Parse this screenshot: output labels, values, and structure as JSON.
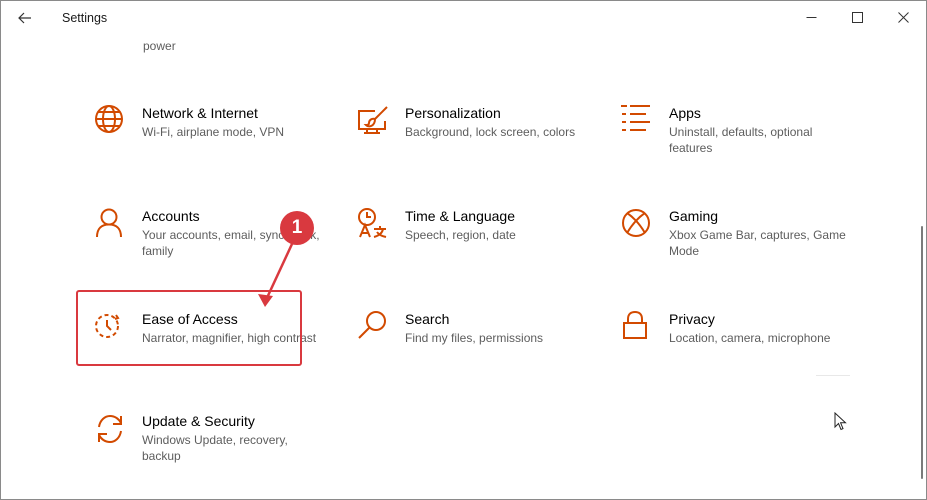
{
  "window": {
    "title": "Settings",
    "back_icon": "back-arrow-icon",
    "controls": [
      "minimize-icon",
      "maximize-icon",
      "close-icon"
    ]
  },
  "partial_row": {
    "descriptions": [
      "power"
    ]
  },
  "accent_color": "#d24a00",
  "annotation_color": "#d9393f",
  "tiles": [
    {
      "title": "Network & Internet",
      "description": "Wi-Fi, airplane mode, VPN",
      "icon": "globe-icon"
    },
    {
      "title": "Personalization",
      "description": "Background, lock screen, colors",
      "icon": "paint-brush-screen-icon"
    },
    {
      "title": "Apps",
      "description": "Uninstall, defaults, optional features",
      "icon": "apps-list-icon"
    },
    {
      "title": "Accounts",
      "description": "Your accounts, email, sync, work, family",
      "icon": "person-icon"
    },
    {
      "title": "Time & Language",
      "description": "Speech, region, date",
      "icon": "time-language-icon"
    },
    {
      "title": "Gaming",
      "description": "Xbox Game Bar, captures, Game Mode",
      "icon": "xbox-icon"
    },
    {
      "title": "Ease of Access",
      "description": "Narrator, magnifier, high contrast",
      "icon": "ease-of-access-icon"
    },
    {
      "title": "Search",
      "description": "Find my files, permissions",
      "icon": "search-icon"
    },
    {
      "title": "Privacy",
      "description": "Location, camera, microphone",
      "icon": "lock-icon"
    },
    {
      "title": "Update & Security",
      "description": "Windows Update, recovery, backup",
      "icon": "sync-arrows-icon"
    }
  ],
  "annotation": {
    "step_number": "1"
  }
}
